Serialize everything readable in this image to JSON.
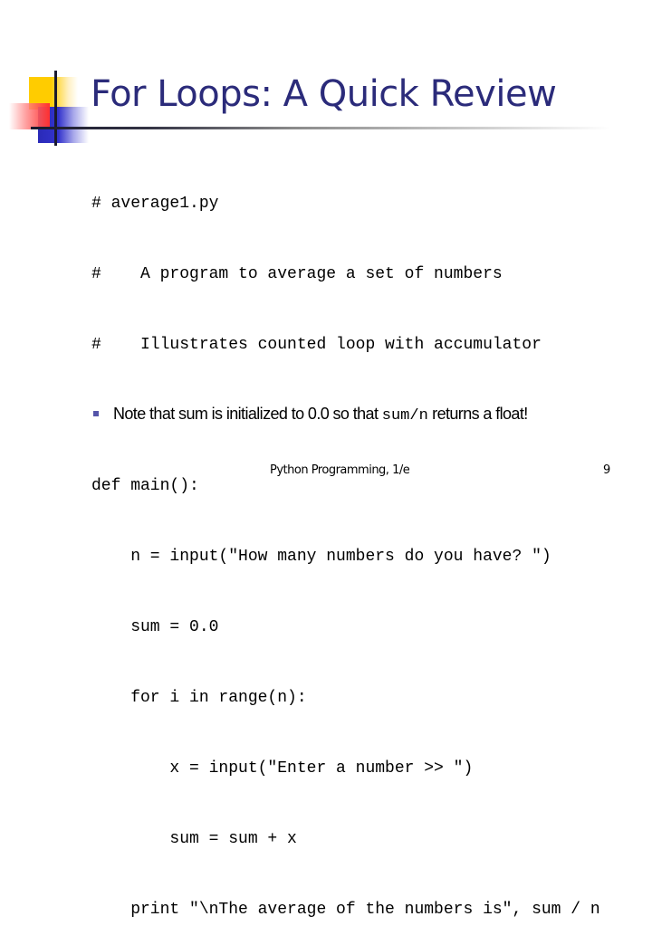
{
  "slide": {
    "title": "For Loops: A Quick Review",
    "code_lines": [
      "# average1.py",
      "#    A program to average a set of numbers",
      "#    Illustrates counted loop with accumulator",
      "",
      "def main():",
      "    n = input(\"How many numbers do you have? \")",
      "    sum = 0.0",
      "    for i in range(n):",
      "        x = input(\"Enter a number >> \")",
      "        sum = sum + x",
      "    print \"\\nThe average of the numbers is\", sum / n"
    ],
    "bullet": {
      "icon": "square-bullet",
      "text_before": "Note that sum is initialized to 0.0 so that ",
      "code": "sum/n",
      "text_after": " returns a float!"
    },
    "footer": {
      "center": "Python Programming, 1/e",
      "page_number": "9"
    },
    "colors": {
      "title": "#2b2b7a",
      "bullet": "#5555aa",
      "accent_yellow": "#ffcc00",
      "accent_blue": "#3333cc",
      "accent_red": "#ff3030"
    }
  }
}
